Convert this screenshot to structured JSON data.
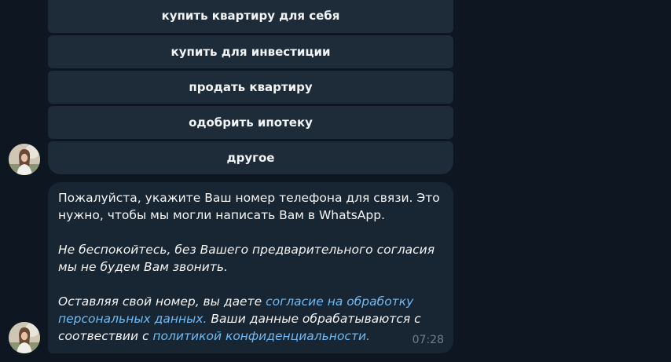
{
  "keyboard": {
    "buttons": [
      "купить квартиру для себя",
      "купить для инвестиции",
      "продать квартиру",
      "одобрить ипотеку",
      "другое"
    ]
  },
  "message": {
    "paragraph1": "Пожалуйста, укажите Ваш номер телефона для связи. Это нужно, чтобы мы могли написать Вам в WhatsApp.",
    "paragraph2": "Не беспокойтесь, без Вашего предварительного согласия мы не будем Вам звонить.",
    "p3_text1": "Оставляя свой номер, вы даете ",
    "p3_link1": "согласие на обработку персональных данных.",
    "p3_text2": " Ваши данные обрабатываются с соотвествии с ",
    "p3_link2": "политикой конфиденциальности.",
    "time": "07:28"
  },
  "colors": {
    "background": "#0e1621",
    "button_bg": "#1e2c3a",
    "bubble_bg": "#182533",
    "link": "#71baf2"
  }
}
